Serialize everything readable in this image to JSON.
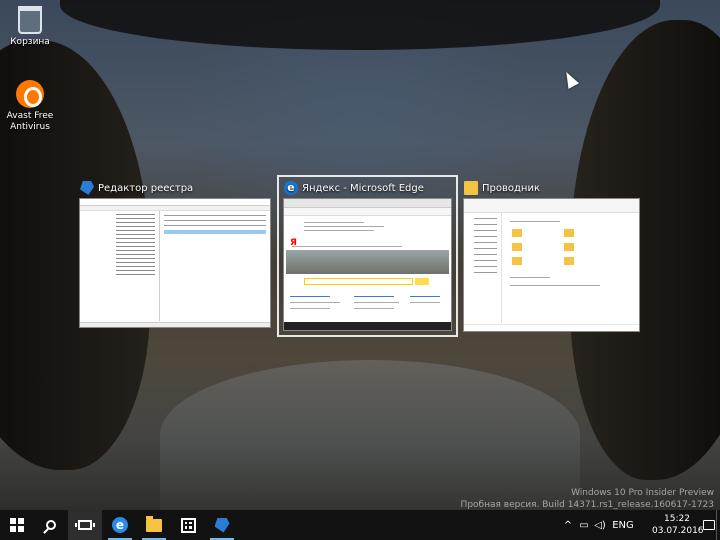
{
  "desktop": {
    "icons": [
      {
        "label": "Корзина",
        "icon": "recycle-bin-icon"
      },
      {
        "label": "Avast Free Antivirus",
        "icon": "avast-icon"
      }
    ]
  },
  "task_view": {
    "windows": [
      {
        "title": "Редактор реестра",
        "icon": "regedit-icon",
        "selected": false
      },
      {
        "title": "Яндекс - Microsoft Edge",
        "icon": "edge-icon",
        "selected": true
      },
      {
        "title": "Проводник",
        "icon": "folder-icon",
        "selected": false
      }
    ]
  },
  "watermark": {
    "line1": "Windows 10 Pro Insider Preview",
    "line2": "Пробная версия. Build 14371.rs1_release.160617-1723"
  },
  "taskbar": {
    "start_icon": "windows-logo-icon",
    "search_icon": "search-icon",
    "task_view_icon": "task-view-icon",
    "pinned": [
      {
        "icon": "edge-icon",
        "running": true
      },
      {
        "icon": "file-explorer-icon",
        "running": true
      },
      {
        "icon": "store-icon",
        "running": false
      },
      {
        "icon": "regedit-icon",
        "running": true
      }
    ],
    "tray": {
      "language": "ENG",
      "time": "15:22",
      "date": "03.07.2016"
    }
  },
  "colors": {
    "taskbar_bg": "#121212",
    "accent": "#76b9ed"
  }
}
